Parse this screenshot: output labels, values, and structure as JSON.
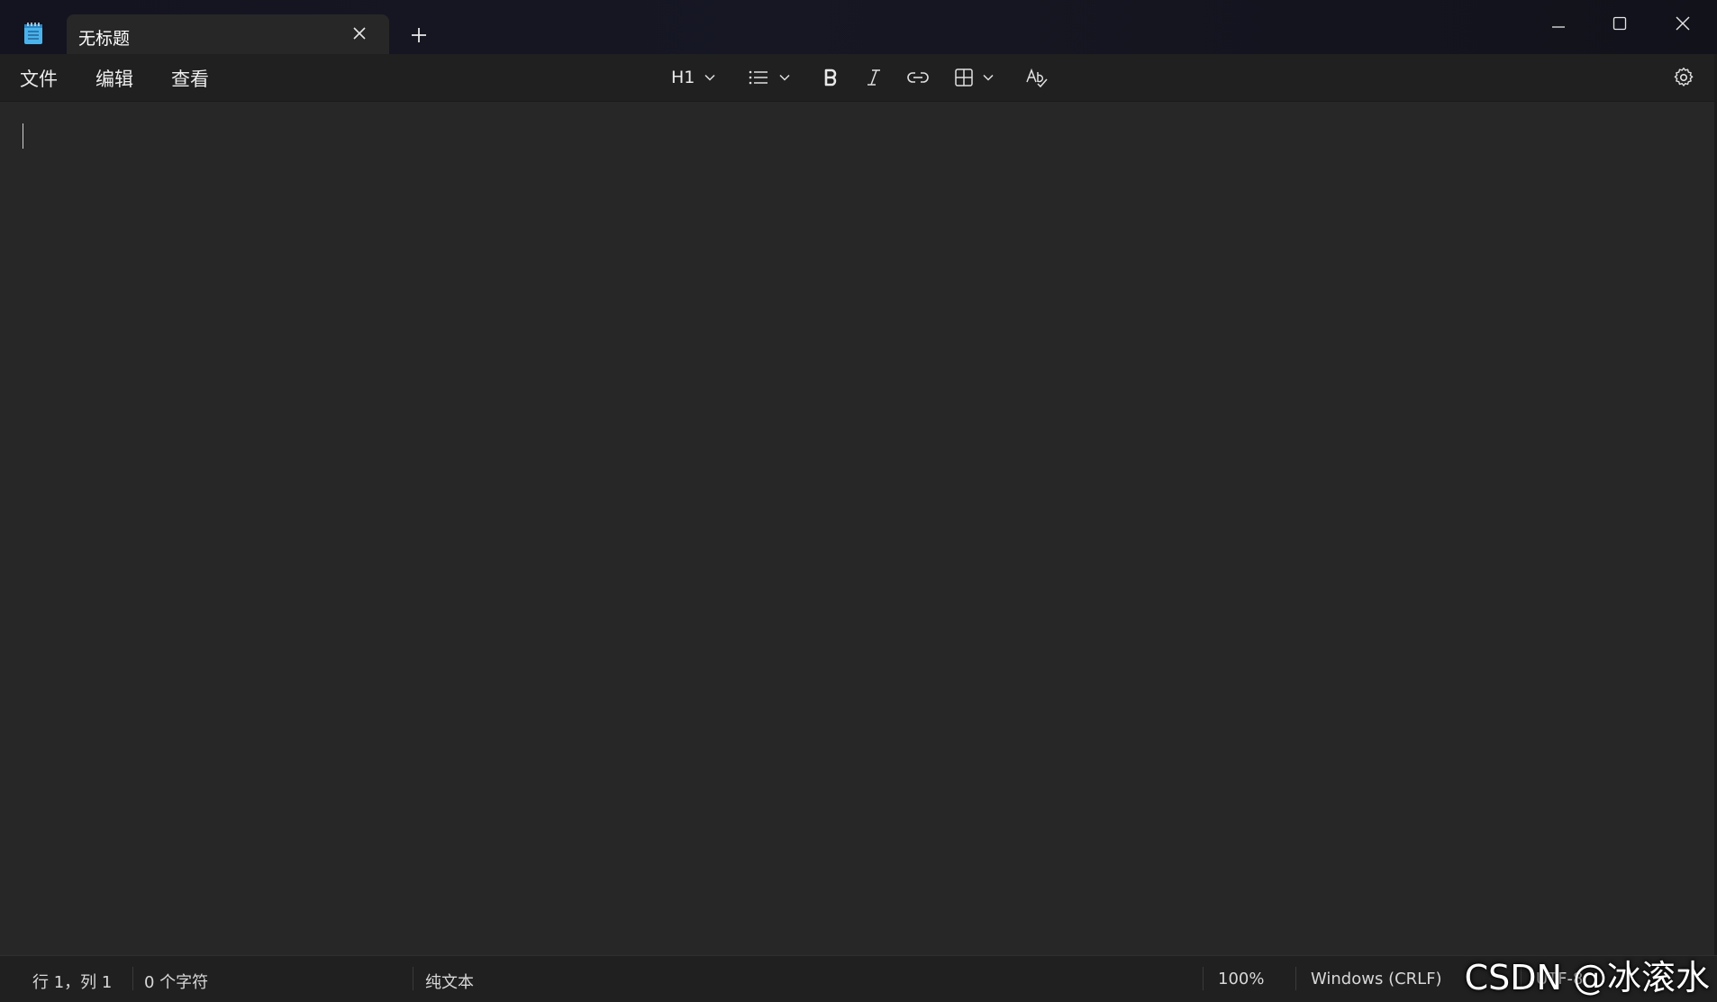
{
  "tab": {
    "title": "无标题"
  },
  "menu": {
    "file": "文件",
    "edit": "编辑",
    "view": "查看"
  },
  "toolbar": {
    "heading_label": "H1"
  },
  "status": {
    "position": "行 1，列 1",
    "chars": "0 个字符",
    "format": "纯文本",
    "zoom": "100%",
    "line_ending": "Windows (CRLF)",
    "encoding": "UTF-8"
  },
  "watermark": "CSDN @冰滚水",
  "icons": {
    "app": "notepad-icon",
    "close_tab": "close-icon",
    "new_tab": "plus-icon",
    "minimize": "minimize-icon",
    "maximize": "maximize-icon",
    "close_window": "close-icon",
    "list": "list-icon",
    "bold": "bold-icon",
    "italic": "italic-icon",
    "link": "link-icon",
    "table": "table-icon",
    "spellcheck": "spellcheck-icon",
    "settings": "gear-icon"
  },
  "colors": {
    "titlebar": "#13141f",
    "editor": "#272727",
    "menubar": "#202020",
    "app_icon": "#3aa0e0"
  }
}
